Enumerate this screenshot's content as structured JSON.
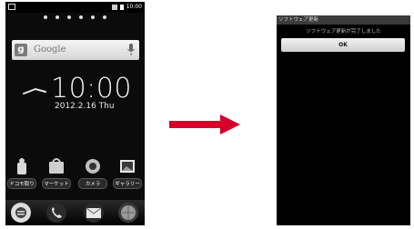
{
  "status_bar": {
    "time": "10:00"
  },
  "search_widget": {
    "brand_badge": "g",
    "placeholder": "Google"
  },
  "clock": {
    "time": "10:00",
    "date": "2012.2.16 Thu"
  },
  "apps": [
    {
      "label": "ドコモ取り",
      "icon": "docomo-app-icon"
    },
    {
      "label": "マーケット",
      "icon": "market-icon"
    },
    {
      "label": "カメラ",
      "icon": "camera-icon"
    },
    {
      "label": "ギャラリー",
      "icon": "gallery-icon"
    }
  ],
  "dock": [
    {
      "icon": "home-launcher-icon"
    },
    {
      "icon": "phone-icon"
    },
    {
      "icon": "mail-icon"
    },
    {
      "icon": "browser-icon"
    }
  ],
  "arrow": {
    "color": "#d6002a"
  },
  "dialog": {
    "title": "ソフトウェア更新",
    "message": "ソフトウェア更新が完了しました",
    "ok_label": "OK"
  }
}
